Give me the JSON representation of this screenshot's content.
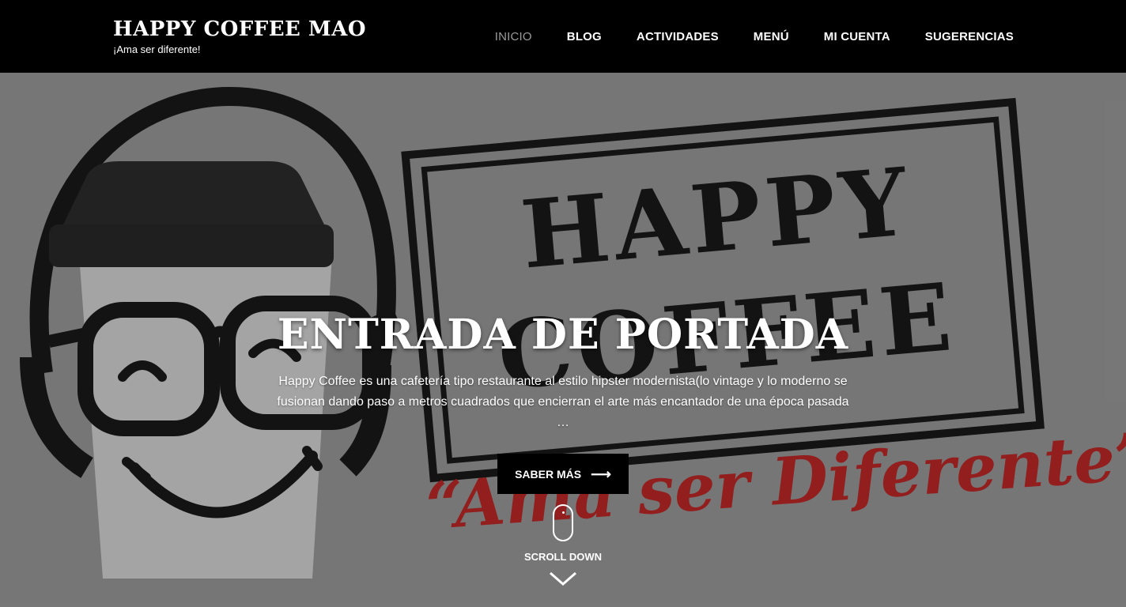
{
  "header": {
    "site_title": "HAPPY COFFEE MAO",
    "tagline": "¡Ama ser diferente!"
  },
  "nav": {
    "items": [
      {
        "label": "INICIO",
        "active": true
      },
      {
        "label": "BLOG",
        "active": false
      },
      {
        "label": "ACTIVIDADES",
        "active": false
      },
      {
        "label": "MENÚ",
        "active": false
      },
      {
        "label": "MI CUENTA",
        "active": false
      },
      {
        "label": "SUGERENCIAS",
        "active": false
      }
    ]
  },
  "hero": {
    "title": "ENTRADA DE PORTADA",
    "text": "Happy Coffee es una cafetería tipo restaurante al estilo hipster modernista(lo vintage y lo moderno se fusionan dando paso a metros cuadrados que encierran el arte más encantador de una época pasada …",
    "button_label": "SABER MÁS",
    "button_icon": "arrow-right-icon",
    "scroll_label": "SCROLL DOWN",
    "logo_lines": [
      "HAPPY",
      "COFFEE"
    ],
    "slogan": "“Ama ser Diferente”"
  },
  "colors": {
    "header_bg": "#000000",
    "nav_active": "#9b9b9b",
    "hero_bg": "#8a8a8a",
    "slogan_red": "#b01010",
    "button_bg": "#000000"
  }
}
